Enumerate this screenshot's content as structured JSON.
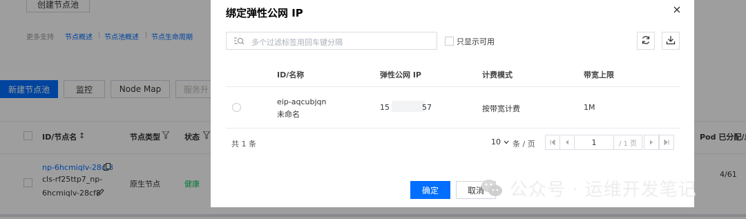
{
  "background": {
    "create_pool_top_label": "创建节点池",
    "more_support_label": "更多支持",
    "help_links": [
      "节点概述",
      "节点池概述",
      "节点生命周期"
    ],
    "separator": "|",
    "toolbar": {
      "new_pool": "新建节点池",
      "monitor": "监控",
      "node_map": "Node Map",
      "service": "服务升"
    },
    "table_headers": {
      "id_name": "ID/节点名",
      "sort_icon": "↕",
      "node_type": "节点类型",
      "status": "状态",
      "filter_icon": "filter-icon",
      "pod_alloc": "Pod 已分配/总"
    },
    "row": {
      "id": "np-6hcmiqlv-28cf8",
      "name_line1": "cls-rf25ttp7_np-",
      "name_line2": "6hcmiqlv-28cf8",
      "type": "原生节点",
      "status": "健康",
      "pod": "4/61"
    }
  },
  "modal": {
    "title": "绑定弹性公网 IP",
    "close_icon": "close-icon",
    "search_placeholder": "多个过滤标签用回车键分隔",
    "only_available_label": "只显示可用",
    "refresh_icon": "refresh-icon",
    "download_icon": "download-icon",
    "columns": [
      "ID/名称",
      "弹性公网 IP",
      "计费模式",
      "带宽上限"
    ],
    "rows": [
      {
        "id": "eip-aqcubjqn",
        "name": "未命名",
        "ip_prefix": "15",
        "ip_suffix": "57",
        "billing": "按带宽计费",
        "bandwidth": "1M"
      }
    ],
    "total_label": "共 1 条",
    "page_size": "10",
    "page_size_unit": "条 / 页",
    "page_input": "1",
    "total_pages": "/ 1 页",
    "confirm_button": "确定",
    "cancel_button": "取消"
  },
  "watermark": {
    "text": "公众号 · 运维开发笔记"
  },
  "colors": {
    "primary": "#006eff",
    "success": "#0abf5b",
    "overlay": "rgba(0,0,0,0.38)"
  }
}
